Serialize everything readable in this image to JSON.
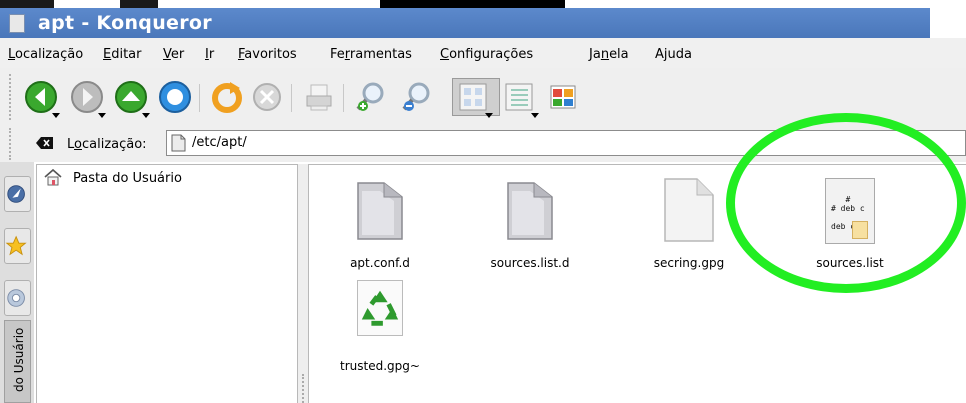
{
  "window": {
    "title": "apt - Konqueror"
  },
  "menubar": [
    {
      "key": "L",
      "rest": "ocalização"
    },
    {
      "key": "E",
      "rest": "ditar"
    },
    {
      "key": "V",
      "rest": "er"
    },
    {
      "key": "I",
      "rest": "r"
    },
    {
      "key": "F",
      "rest": "avoritos"
    },
    {
      "pre": "Fe",
      "key": "r",
      "rest": "ramentas"
    },
    {
      "key": "C",
      "rest": "onfigurações"
    },
    {
      "pre": "Ja",
      "key": "n",
      "rest": "ela"
    },
    {
      "pre": "",
      "key": "",
      "rest": "Ajuda"
    }
  ],
  "toolbar": {
    "icons": [
      "back-icon",
      "forward-icon",
      "up-icon",
      "home-icon",
      "reload-icon",
      "stop-icon",
      "print-icon",
      "zoom-in-icon",
      "zoom-out-icon",
      "icon-view-icon",
      "detailed-view-icon",
      "split-view-icon"
    ]
  },
  "location": {
    "label_key": "o",
    "label_pre": "L",
    "label_rest": "calização:",
    "value": "/etc/apt/"
  },
  "sidebar": {
    "tree_root": "Pasta do Usuário",
    "vertical_tab": "do Usuário"
  },
  "files": [
    {
      "name": "apt.conf.d",
      "type": "folder"
    },
    {
      "name": "sources.list.d",
      "type": "folder"
    },
    {
      "name": "secring.gpg",
      "type": "blank"
    },
    {
      "name": "sources.list",
      "type": "text"
    },
    {
      "name": "trusted.gpg~",
      "type": "recycle"
    }
  ],
  "text_file_preview": {
    "line1": "#",
    "line2": "# deb c",
    "line3": "deb cdr"
  },
  "colors": {
    "titlebar": "#5383c8",
    "annotation": "#22ee22"
  }
}
